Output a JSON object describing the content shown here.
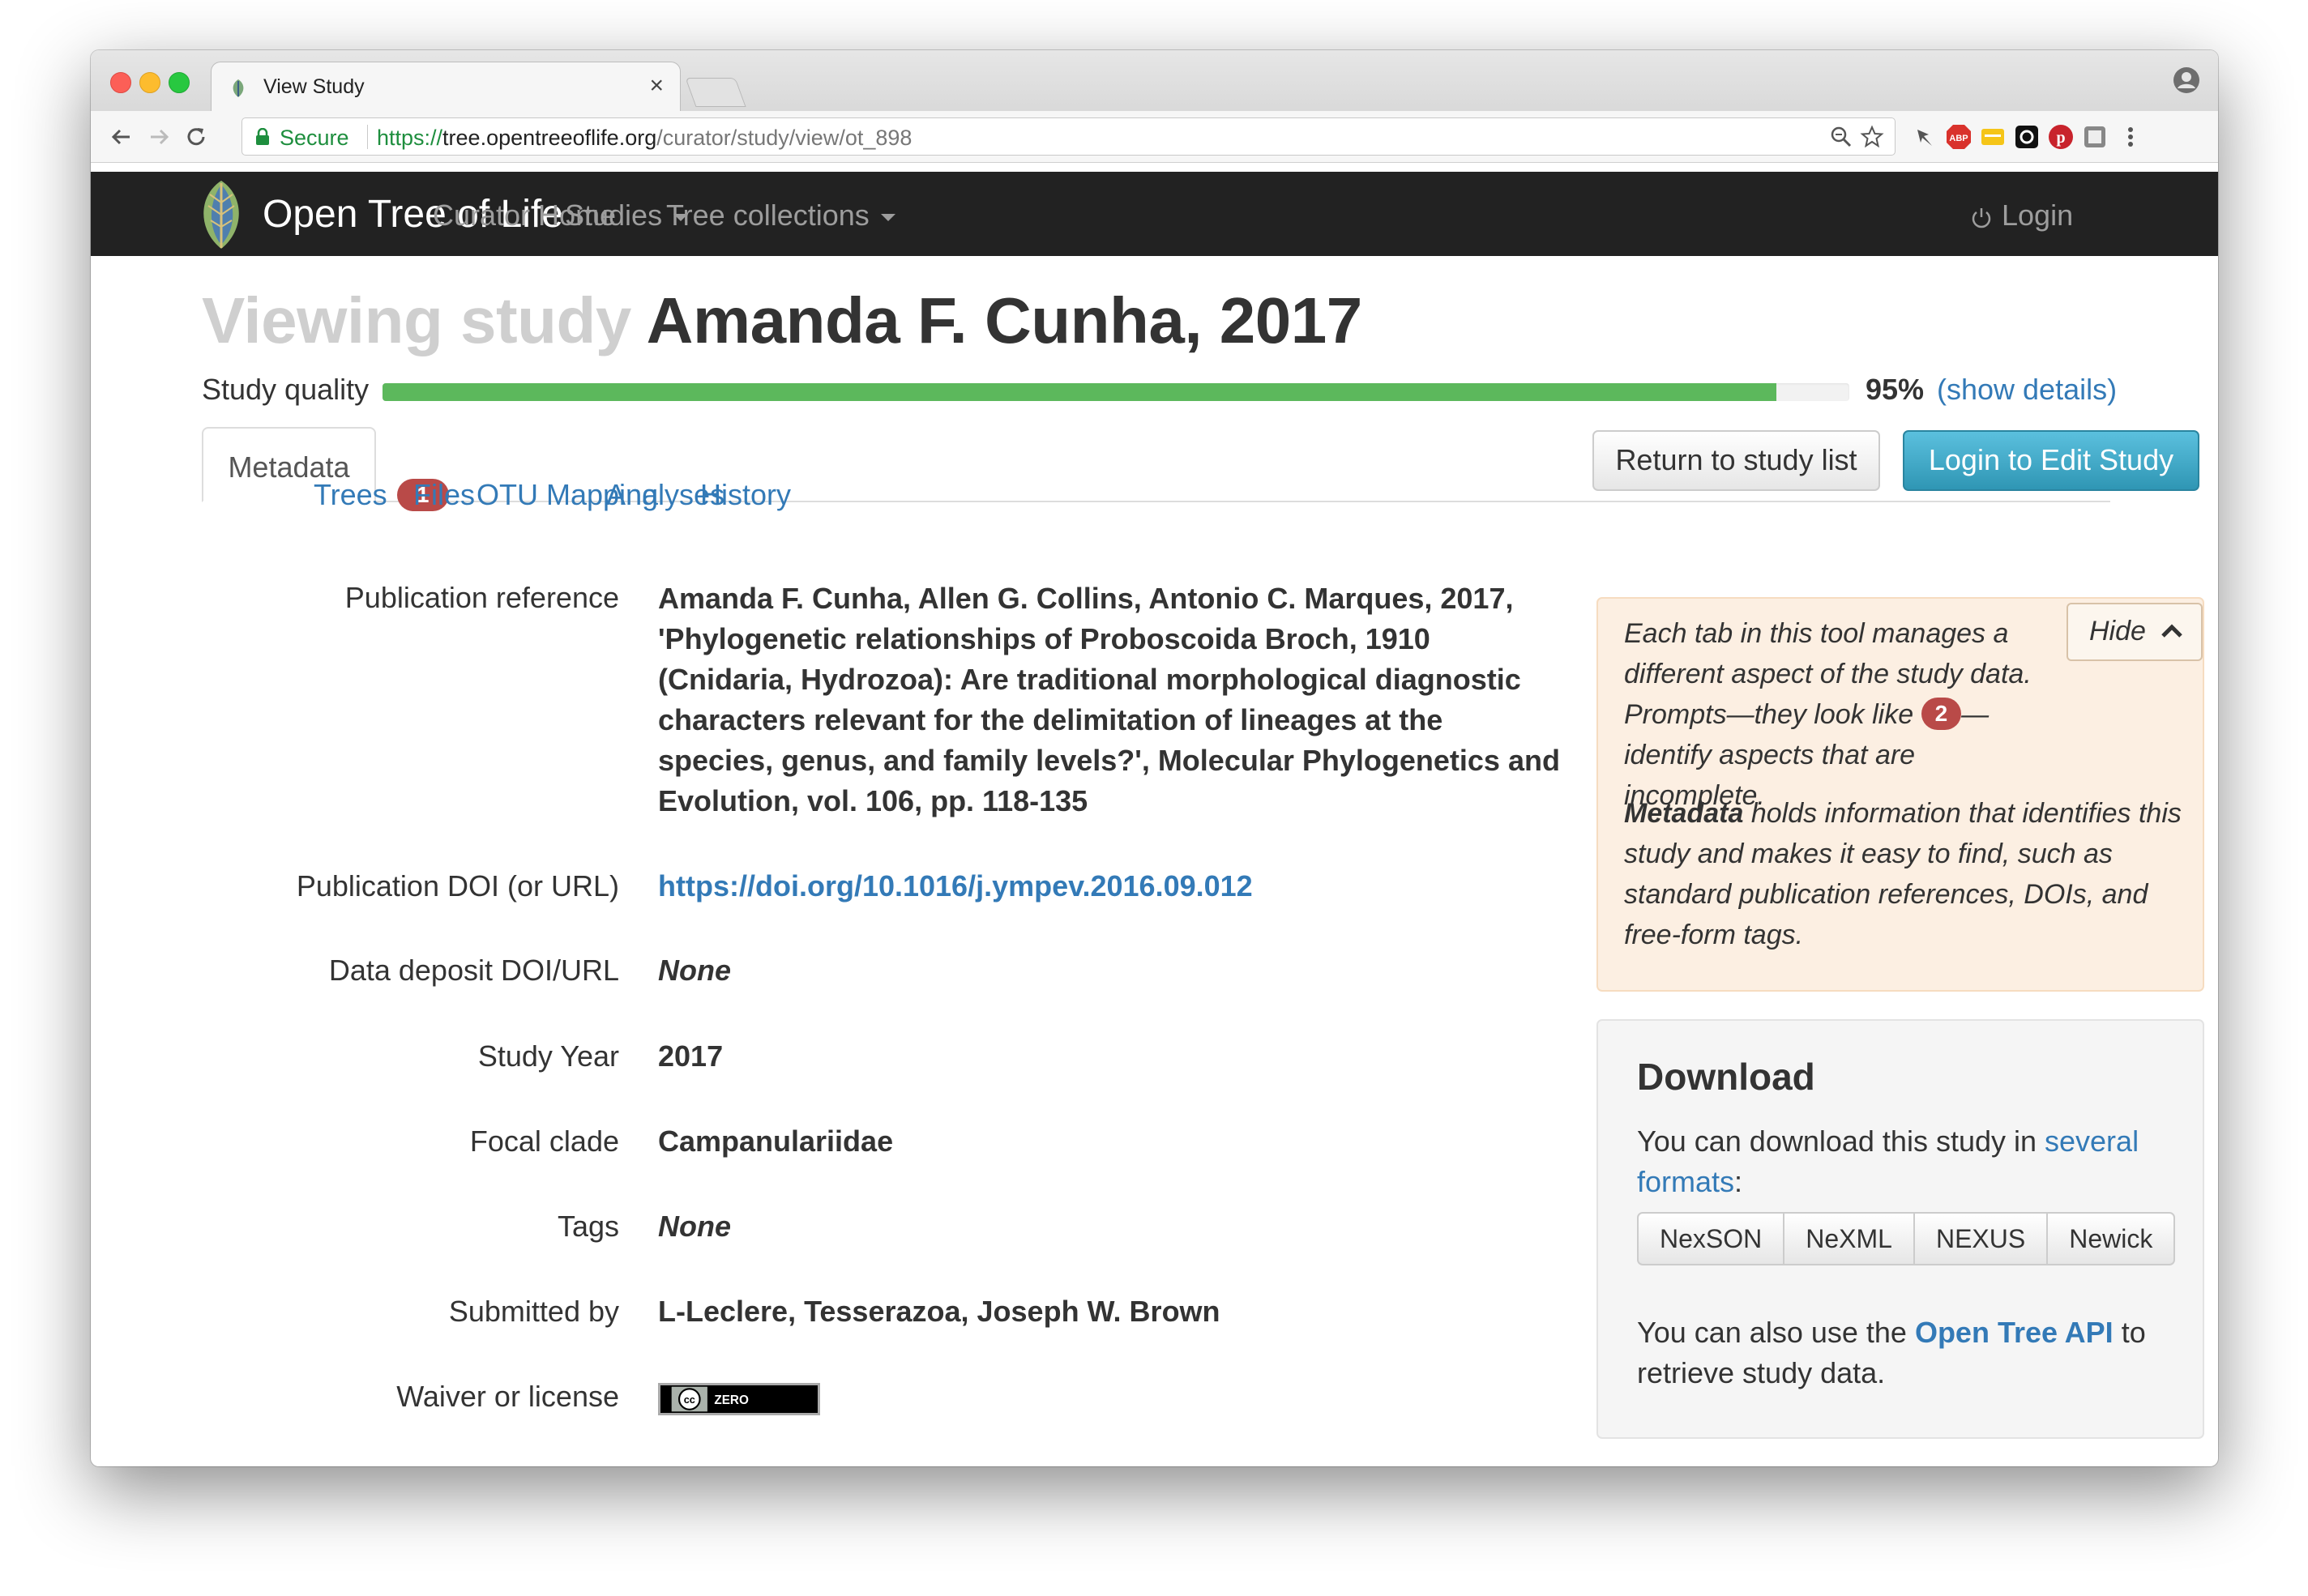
{
  "browser": {
    "tab_title": "View Study",
    "tab_close": "×",
    "secure_label": "Secure",
    "url_scheme": "https://",
    "url_host": "tree.opentreeoflife.org",
    "url_path": "/curator/study/view/ot_898"
  },
  "navbar": {
    "brand": "Open Tree of Life",
    "links": [
      "Curator Home",
      "Studies",
      "Tree collections"
    ],
    "login": "Login"
  },
  "page": {
    "title_prefix": "Viewing study",
    "title_main": "Amanda F. Cunha, 2017"
  },
  "quality": {
    "label": "Study quality",
    "percent": 95,
    "percent_text": "95%",
    "details_link": "(show details)"
  },
  "tabs": {
    "metadata": "Metadata",
    "trees": "Trees",
    "trees_badge": "1",
    "files": "Files",
    "otu_mapping": "OTU Mapping",
    "analyses": "Analyses",
    "history": "History"
  },
  "actions": {
    "return_label": "Return to study list",
    "edit_label": "Login to Edit Study"
  },
  "metadata": {
    "pubref_label": "Publication reference",
    "pubref_value": "Amanda F. Cunha, Allen G. Collins, Antonio C. Marques, 2017, 'Phylogenetic relationships of Proboscoida Broch, 1910 (Cnidaria, Hydrozoa): Are traditional morphological diagnostic characters relevant for the delimitation of lineages at the species, genus, and family levels?', Molecular Phylogenetics and Evolution, vol. 106, pp. 118-135",
    "doi_label": "Publication DOI (or URL)",
    "doi_value": "https://doi.org/10.1016/j.ympev.2016.09.012",
    "deposit_label": "Data deposit DOI/URL",
    "deposit_value": "None",
    "year_label": "Study Year",
    "year_value": "2017",
    "clade_label": "Focal clade",
    "clade_value": "Campanulariidae",
    "tags_label": "Tags",
    "tags_value": "None",
    "submitted_label": "Submitted by",
    "submitted_value": "L-Leclere, Tesserazoa, Joseph W. Brown",
    "license_label": "Waiver or license",
    "license_badge": "ZERO"
  },
  "help": {
    "p1_a": "Each tab in this tool manages a different aspect of the study data. Prompts—they look like ",
    "p1_badge": "2",
    "p1_b": "—identify aspects that are incomplete.",
    "p2_bold": "Metadata",
    "p2_rest": " holds information that identifies this study and makes it easy to find, such as standard publication references, DOIs, and free-form tags.",
    "hide_label": "Hide"
  },
  "download": {
    "title": "Download",
    "text_a": "You can download this study in ",
    "formats_link": "several formats",
    "text_b": ":",
    "formats": [
      "NexSON",
      "NeXML",
      "NEXUS",
      "Newick"
    ],
    "api_a": "You can also use the ",
    "api_link": "Open Tree API",
    "api_b": " to retrieve study data."
  }
}
